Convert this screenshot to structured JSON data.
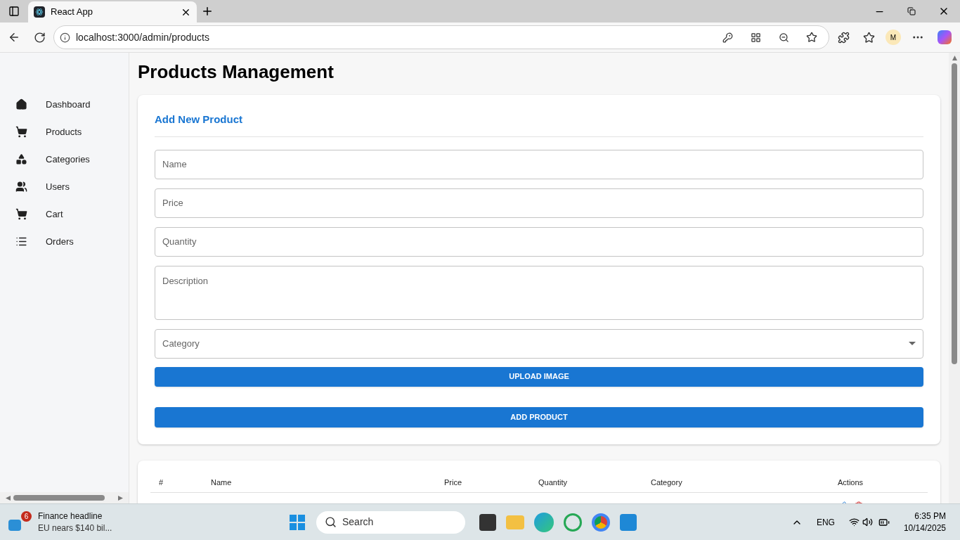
{
  "browser": {
    "tab_title": "React App",
    "url": "localhost:3000/admin/products",
    "profile": "M"
  },
  "sidebar": {
    "items": [
      {
        "label": "Dashboard",
        "selected": false
      },
      {
        "label": "Products",
        "selected": false
      },
      {
        "label": "Categories",
        "selected": false
      },
      {
        "label": "Users",
        "selected": false
      },
      {
        "label": "Cart",
        "selected": false
      },
      {
        "label": "Orders",
        "selected": false
      }
    ]
  },
  "page_title": "Products Management",
  "form": {
    "title": "Add New Product",
    "fields": [
      {
        "placeholder": "Name",
        "kind": "text"
      },
      {
        "placeholder": "Price",
        "kind": "text"
      },
      {
        "placeholder": "Quantity",
        "kind": "text"
      },
      {
        "placeholder": "Description",
        "kind": "textarea"
      },
      {
        "placeholder": "Category",
        "kind": "select"
      }
    ],
    "upload_button": "UPLOAD IMAGE",
    "submit_button": "ADD PRODUCT"
  },
  "table": {
    "columns": [
      "#",
      "Name",
      "Price",
      "Quantity",
      "Category",
      "Actions"
    ]
  },
  "taskbar": {
    "news_badge": "6",
    "news_title": "Finance headline",
    "news_text": "EU nears $140 bil...",
    "search": "Search",
    "language": "ENG",
    "time": "6:35 PM",
    "date": "10/14/2025"
  }
}
